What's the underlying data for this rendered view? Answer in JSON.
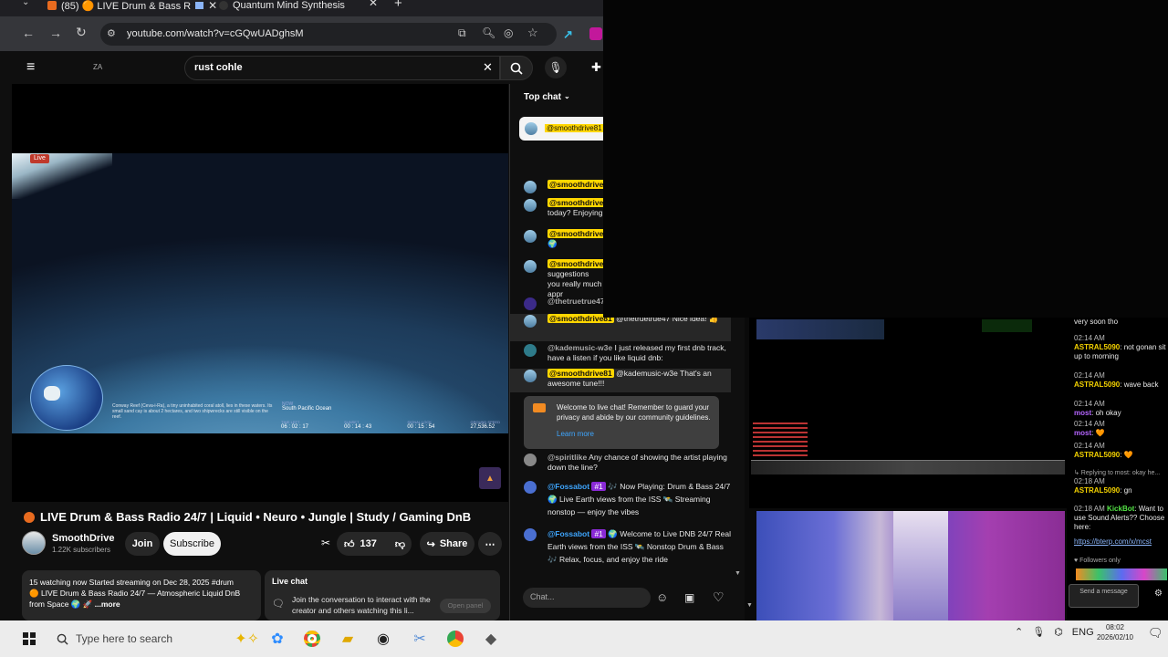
{
  "browser": {
    "tabs": [
      {
        "label": "(85) 🟠 LIVE Drum & Bass R",
        "audio": true
      },
      {
        "label": "Quantum Mind Synthesis"
      }
    ],
    "url": "youtube.com/watch?v=cGQwUADghsM"
  },
  "youtube": {
    "brand_short": "ZA",
    "search_value": "rust cohle",
    "video": {
      "live_label": "Live",
      "overlay_caption": "Conway Reef (Ceva-i-Ra), a tiny uninhabited coral atoll, lies in these waters. Its small sand cay is about 2 hectares, and two shipwrecks are still visible on the reef.",
      "location_label": "NOW",
      "location": "South Pacific Ocean",
      "stats": [
        {
          "label": "TIME LEFT",
          "value": "06 : 02 : 17"
        },
        {
          "label": "SUNSET",
          "value": "00 : 14 : 43"
        },
        {
          "label": "SIGNAL LOCK",
          "value": "00 : 15 : 54"
        },
        {
          "label": "GROUND SPEED",
          "value": "27,536.52"
        }
      ]
    },
    "title": "LIVE Drum & Bass Radio 24/7 | Liquid • Neuro • Jungle | Study / Gaming DnB",
    "channel": {
      "name": "SmoothDrive",
      "subscribers": "1.22K subscribers"
    },
    "join_label": "Join",
    "subscribe_label": "Subscribe",
    "likes": "137",
    "share_label": "Share",
    "description": {
      "line1": "15 watching now  Started streaming on Dec 28, 2025  #drum",
      "line2": "🟠 LIVE Drum & Bass Radio 24/7 — Atmospheric Liquid DnB",
      "line3": "from Space 🌍 🚀",
      "more": "...more"
    },
    "live_chat_card": {
      "title": "Live chat",
      "text": "Join the conversation to interact with the creator and others watching this li...",
      "button": "Open panel"
    }
  },
  "chat": {
    "header": "Top chat",
    "pinned_name": "@smoothdrive81",
    "messages": [
      {
        "author": "@smoothdrive8",
        "text": "",
        "style": "owner"
      },
      {
        "author": "@smoothdrive8",
        "text": "today? Enjoying t",
        "style": "owner"
      },
      {
        "author": "@smoothdrive8",
        "text": "🌍",
        "style": "owner"
      },
      {
        "author": "@smoothdrive8",
        "text": "suggestions you really much appr",
        "style": "owner"
      },
      {
        "author": "@thetruetrue47",
        "text": "",
        "style": "plain"
      },
      {
        "author": "@smoothdrive81",
        "text": "@thetruetrue47 Nice idea! 👍",
        "style": "owner"
      },
      {
        "author": "@kademusic-w3e",
        "text": "I just released my first dnb track, have a listen if you like liquid dnb:",
        "style": "plain"
      },
      {
        "author": "@smoothdrive81",
        "text": "@kademusic-w3e That's an awesome tune!!!",
        "style": "owner"
      }
    ],
    "welcome_text": "Welcome to live chat! Remember to guard your privacy and abide by our community guidelines.",
    "learn_more": "Learn more",
    "later_messages": [
      {
        "author": "@spiritlike",
        "text": "Any chance of showing the artist playing down the line?",
        "style": "plain"
      },
      {
        "author": "@Fossabot",
        "badge": "#1",
        "text": "🎶 Now Playing: Drum & Bass 24/7 🌍 Live Earth views from the ISS 🛰️ Streaming nonstop — enjoy the vibes",
        "style": "bot"
      },
      {
        "author": "@Fossabot",
        "badge": "#1",
        "text": "🌍 Welcome to Live DNB 24/7 Real Earth views from the ISS 🛰️ Nonstop Drum & Bass 🎶 Relax, focus, and enjoy the ride",
        "style": "bot"
      }
    ],
    "input_placeholder": "Chat..."
  },
  "side_chat": {
    "lines": [
      {
        "time": "",
        "user": "",
        "text": "very soon tho"
      },
      {
        "time": "02:14 AM",
        "user": "ASTRAL5090",
        "text": ": not gonan sit up to morning",
        "color": "yellow"
      },
      {
        "time": "02:14 AM",
        "user": "ASTRAL5090",
        "text": ": wave back",
        "color": "yellow"
      },
      {
        "time": "02:14 AM",
        "user": "most",
        "text": ": oh okay",
        "color": "purple"
      },
      {
        "time": "02:14 AM",
        "user": "most",
        "text": ": 🧡",
        "color": "purple"
      },
      {
        "time": "02:14 AM",
        "user": "ASTRAL5090",
        "text": ": 🧡",
        "color": "yellow"
      },
      {
        "time": "",
        "user": "",
        "text": "↳ Replying to most: okay he..."
      },
      {
        "time": "02:18 AM",
        "user": "ASTRAL5090",
        "text": ": gn",
        "color": "yellow"
      },
      {
        "time": "02:18 AM",
        "user": "KickBot",
        "text": ": Want to use Sound Alerts?? Choose here:",
        "color": "green"
      },
      {
        "time": "",
        "user": "",
        "text": "https://bterp.com/x/mcst"
      }
    ],
    "followers_only": "Followers only",
    "send_button": "Send a message"
  },
  "taskbar": {
    "search_placeholder": "Type here to search",
    "language": "ENG",
    "time": "08:02",
    "date": "2026/02/10"
  },
  "colors": {
    "chrome_bg": "#35363a",
    "yt_bg": "#0f0f0f",
    "owner_badge": "#ffd600",
    "subscribe_bg": "#f1f1f1",
    "taskbar_bg": "#ececec"
  }
}
